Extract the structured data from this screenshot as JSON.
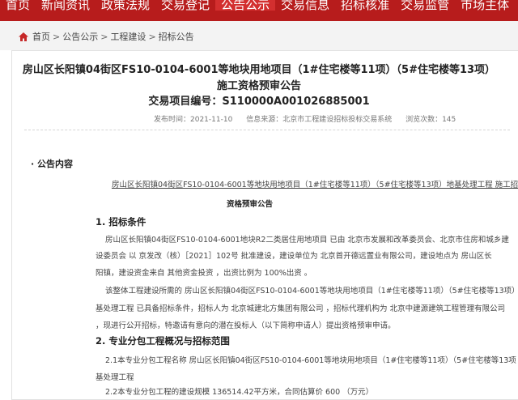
{
  "nav": {
    "items": [
      "首页",
      "新闻资讯",
      "政策法规",
      "交易登记",
      "公告公示",
      "交易信息",
      "招标核准",
      "交易监管",
      "市场主体"
    ],
    "active_index": 4
  },
  "breadcrumb": {
    "items": [
      "首页",
      "公告公示",
      "工程建设",
      "招标公告"
    ],
    "separator": ">"
  },
  "article": {
    "title_line1": "房山区长阳镇04街区FS10-0104-6001等地块用地项目（1#住宅楼等11项）（5#住宅楼等13项）",
    "title_line2": "施工资格预审公告",
    "code": "交易项目编号：S110000A001026885001",
    "publish_time": "发布时间：2021-11-10",
    "source": "信息来源：北京市工程建设招标投标交易系统",
    "views": "浏览次数：145",
    "section_label": "· 公告内容",
    "subject_line": "房山区长阳镇04街区FS10-0104-6001等地块用地项目（1#住宅楼等11项）（5#住宅楼等13项）地基处理工程 施工招标",
    "notice_title": "资格预审公告",
    "h1": "1. 招标条件",
    "p1_l1": "房山区长阳镇04街区FS10-0104-6001地块R2二类居住用地项目 已由 北京市发展和改革委员会、北京市住房和城乡建",
    "p1_l2": "设委员会 以 京发改（核）［2021］102号 批准建设，建设单位为 北京首开德远置业有限公司，建设地点为 房山区长",
    "p1_l3": "阳镇，建设资金来自 其他资金投资 ，出资比例为 100%出资 。",
    "p2_l1": "该整体工程建设所需的 房山区长阳镇04街区FS10-0104-6001等地块用地项目（1#住宅楼等11项）（5#住宅楼等13项）地",
    "p2_l2": "基处理工程 已具备招标条件，招标人为 北京城建北方集团有限公司 ，招标代理机构为 北京中建源建筑工程管理有限公司",
    "p2_l3": "，现进行公开招标，特邀请有意向的潜在投标人（以下简称申请人）提出资格预审申请。",
    "h2": "2. 专业分包工程概况与招标范围",
    "p3_l1": "2.1本专业分包工程名称 房山区长阳镇04街区FS10-0104-6001等地块用地项目（1#住宅楼等11项）（5#住宅楼等13项",
    "p3_l2": "基处理工程",
    "p3_l3": "2.2本专业分包工程的建设规模 136514.42平方米，合同估算价 600 （万元）"
  },
  "colors": {
    "nav_bg": "#b71c1c",
    "nav_active": "#d32f2f"
  },
  "icons": [
    "home-icon"
  ]
}
